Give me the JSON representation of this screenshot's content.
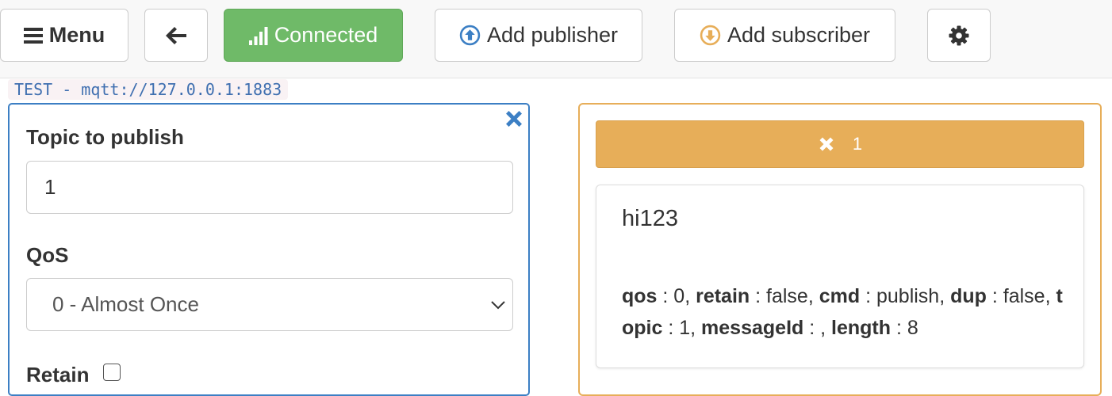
{
  "toolbar": {
    "menu_label": "Menu",
    "connected_label": "Connected",
    "add_publisher_label": "Add publisher",
    "add_subscriber_label": "Add subscriber"
  },
  "connection": {
    "label": "TEST - mqtt://127.0.0.1:1883"
  },
  "publisher": {
    "topic_label": "Topic to publish",
    "topic_value": "1",
    "qos_label": "QoS",
    "qos_selected": "0 - Almost Once",
    "retain_label": "Retain",
    "retain_checked": false
  },
  "subscriber": {
    "topic": "1",
    "message": {
      "payload": "hi123",
      "qos_key": "qos",
      "qos_val": " : 0, ",
      "retain_key": "retain",
      "retain_val": " : false, ",
      "cmd_key": "cmd",
      "cmd_val": " : publish, ",
      "dup_key": "dup",
      "dup_val": " : false, ",
      "topic_key": "topic",
      "topic_val": " : 1, ",
      "messageid_key": "messageId",
      "messageid_val": " : , ",
      "length_key": "length",
      "length_val": " : 8"
    }
  },
  "colors": {
    "success": "#6fba68",
    "primary": "#3c7fc4",
    "warning": "#e7ae59",
    "icon_blue": "#3c7fc4",
    "icon_orange": "#e7ae59"
  },
  "icons": {
    "menu": "hamburger-icon",
    "back": "arrow-left-icon",
    "connected": "signal-icon",
    "add_publisher": "arrow-circle-up-icon",
    "add_subscriber": "arrow-circle-down-icon",
    "settings": "gear-icon",
    "close": "close-icon",
    "subscriber_close": "close-icon"
  }
}
